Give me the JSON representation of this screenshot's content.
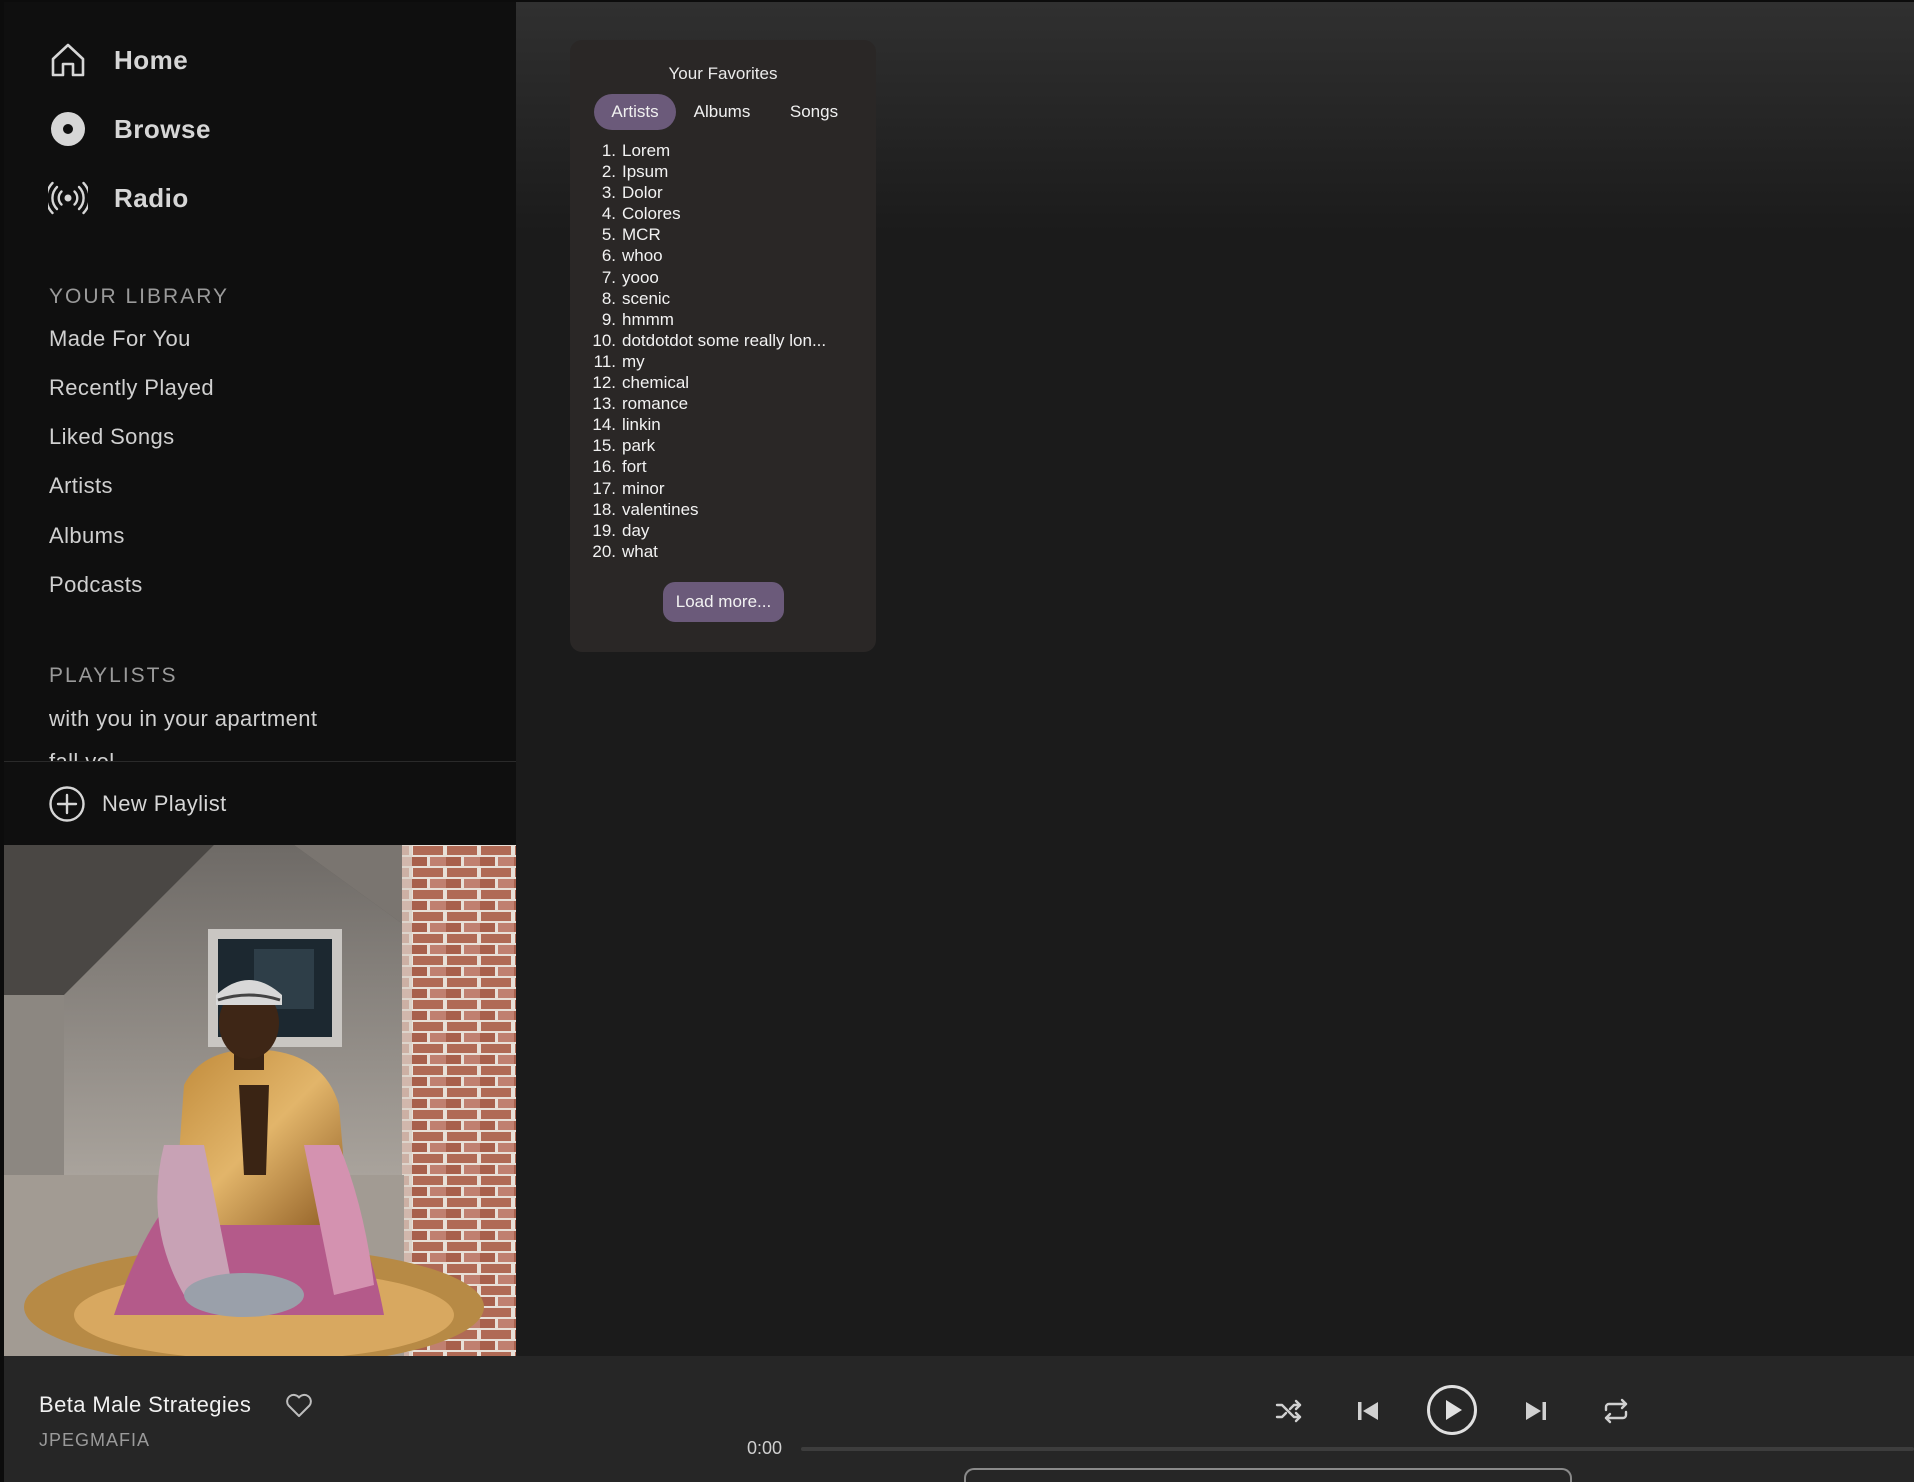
{
  "nav": {
    "home": "Home",
    "browse": "Browse",
    "radio": "Radio"
  },
  "library": {
    "title": "YOUR LIBRARY",
    "items": [
      "Made For You",
      "Recently Played",
      "Liked Songs",
      "Artists",
      "Albums",
      "Podcasts"
    ]
  },
  "playlists": {
    "title": "PLAYLISTS",
    "items": [
      "with you in your apartment",
      "fall vol."
    ]
  },
  "new_playlist": "New Playlist",
  "favorites": {
    "title": "Your Favorites",
    "tabs": [
      "Artists",
      "Albums",
      "Songs"
    ],
    "active_tab": "Artists",
    "items": [
      {
        "num": "1.",
        "name": "Lorem"
      },
      {
        "num": "2.",
        "name": "Ipsum"
      },
      {
        "num": "3.",
        "name": "Dolor"
      },
      {
        "num": "4.",
        "name": "Colores"
      },
      {
        "num": "5.",
        "name": "MCR"
      },
      {
        "num": "6.",
        "name": "whoo"
      },
      {
        "num": "7.",
        "name": "yooo"
      },
      {
        "num": "8.",
        "name": "scenic"
      },
      {
        "num": "9.",
        "name": "hmmm"
      },
      {
        "num": "10.",
        "name": "dotdotdot some really lon..."
      },
      {
        "num": "11.",
        "name": "my"
      },
      {
        "num": "12.",
        "name": "chemical"
      },
      {
        "num": "13.",
        "name": "romance"
      },
      {
        "num": "14.",
        "name": "linkin"
      },
      {
        "num": "15.",
        "name": "park"
      },
      {
        "num": "16.",
        "name": "fort"
      },
      {
        "num": "17.",
        "name": "minor"
      },
      {
        "num": "18.",
        "name": "valentines"
      },
      {
        "num": "19.",
        "name": "day"
      },
      {
        "num": "20.",
        "name": "what"
      }
    ],
    "load_more": "Load more..."
  },
  "player": {
    "title": "Beta Male Strategies",
    "artist": "JPEGMAFIA",
    "current_time": "0:00",
    "progress": 0
  },
  "colors": {
    "accent": "#6b5a7a",
    "sidebar_bg": "#0f0f0f",
    "main_bg": "#1b1b1b",
    "card_bg": "#2a2726",
    "player_bg": "#262626"
  },
  "icons": {
    "home": "home-icon",
    "browse": "disc-icon",
    "radio": "radio-broadcast-icon",
    "new_playlist": "plus-circle-icon",
    "like": "heart-icon",
    "shuffle": "shuffle-icon",
    "previous": "skip-previous-icon",
    "play": "play-icon",
    "next": "skip-next-icon",
    "repeat": "repeat-icon"
  }
}
